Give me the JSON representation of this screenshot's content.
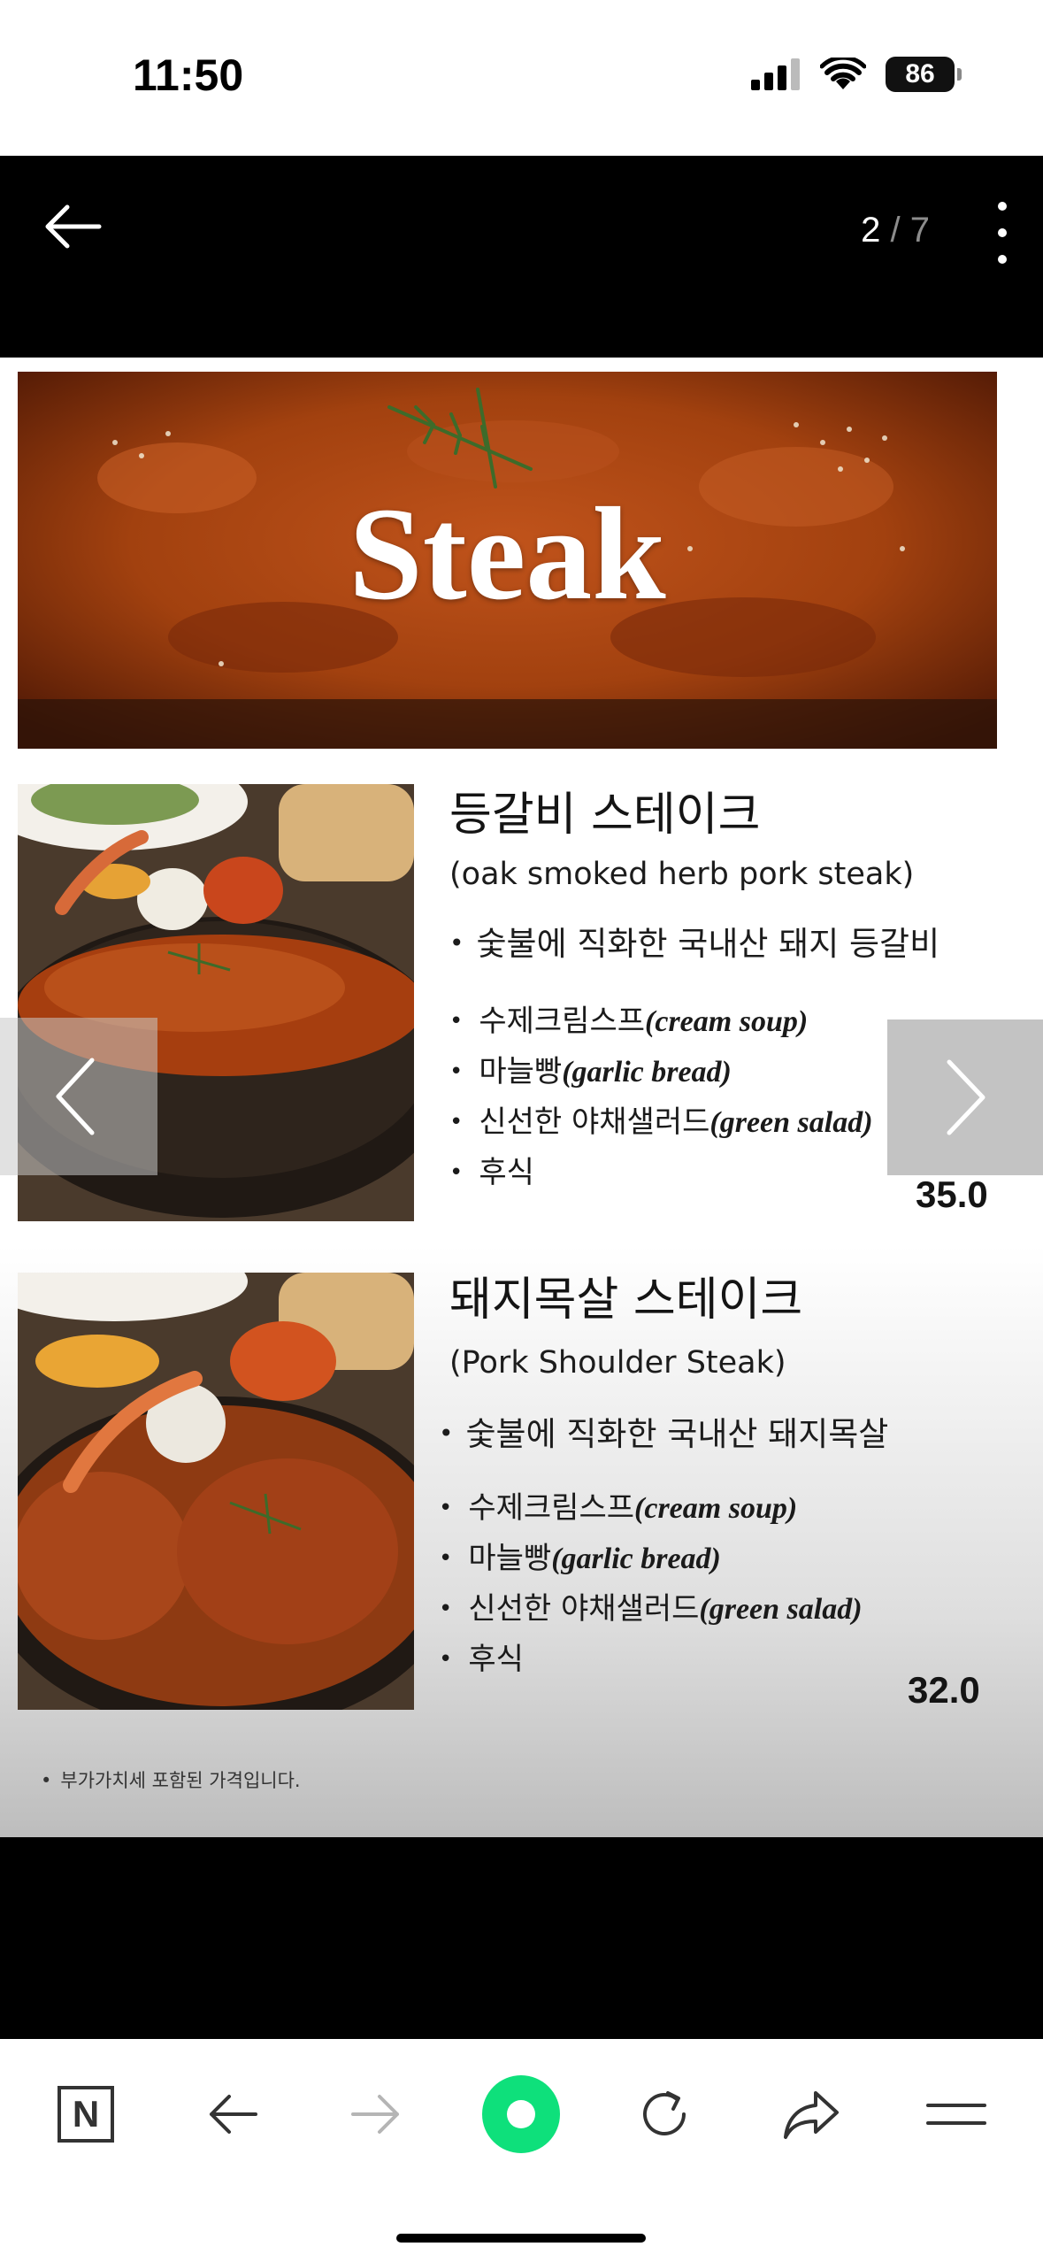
{
  "status_bar": {
    "time": "11:50",
    "battery": "86"
  },
  "viewer": {
    "page_current": "2",
    "page_separator": "/",
    "page_total": "7"
  },
  "menu": {
    "hero_title": "Steak",
    "items": [
      {
        "name": "등갈비 스테이크",
        "subtitle": "(oak smoked herb pork steak)",
        "description": "숯불에 직화한 국내산 돼지 등갈비",
        "includes": [
          {
            "ko": "수제크림스프",
            "en": "(cream soup)"
          },
          {
            "ko": "마늘빵",
            "en": "(garlic bread)"
          },
          {
            "ko": "신선한 야채샐러드",
            "en": "(green salad)"
          },
          {
            "ko": "후식",
            "en": ""
          }
        ],
        "price": "35.0"
      },
      {
        "name": "돼지목살 스테이크",
        "subtitle": "(Pork Shoulder Steak)",
        "description": "숯불에 직화한 국내산 돼지목살",
        "includes": [
          {
            "ko": "수제크림스프",
            "en": "(cream soup)"
          },
          {
            "ko": "마늘빵",
            "en": "(garlic bread)"
          },
          {
            "ko": "신선한 야채샐러드",
            "en": "(green salad)"
          },
          {
            "ko": "후식",
            "en": ""
          }
        ],
        "price": "32.0"
      }
    ],
    "vat_note": "부가가치세 포함된 가격입니다."
  },
  "toolbar": {
    "naver_label": "N"
  },
  "colors": {
    "accent_green": "#0ee07b",
    "sauce": "#9a3a10",
    "dark": "#000000"
  },
  "icons": [
    "back-arrow-icon",
    "more-vertical-icon",
    "chevron-left-icon",
    "chevron-right-icon",
    "naver-n-icon",
    "browser-back-icon",
    "browser-forward-icon",
    "green-dot-icon",
    "reload-icon",
    "share-icon",
    "menu-icon",
    "signal-icon",
    "wifi-icon",
    "battery-icon"
  ]
}
